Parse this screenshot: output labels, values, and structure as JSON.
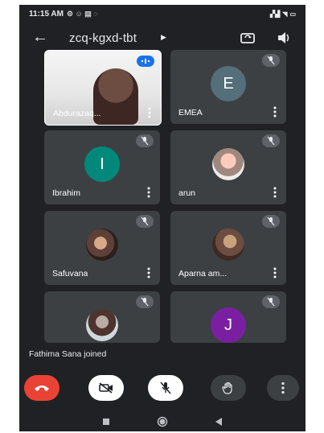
{
  "status": {
    "time": "11:15 AM"
  },
  "meeting": {
    "code": "zcq-kgxd-tbt"
  },
  "participants": [
    {
      "name": "Abdurazaq...",
      "type": "photo",
      "speaking": true
    },
    {
      "name": "EMEA",
      "type": "letter",
      "letter": "E",
      "color": "#546e7a",
      "muted": true
    },
    {
      "name": "Ibrahim",
      "type": "letter",
      "letter": "I",
      "color": "#00897b",
      "muted": true
    },
    {
      "name": "arun",
      "type": "photo",
      "muted": true
    },
    {
      "name": "Safuvana",
      "type": "photo",
      "muted": true
    },
    {
      "name": "Aparna am...",
      "type": "photo",
      "muted": true
    },
    {
      "name": "",
      "type": "photo",
      "muted": true
    },
    {
      "name": "",
      "type": "letter",
      "letter": "J",
      "color": "#7b1fa2",
      "muted": true
    }
  ],
  "toast": "Fathima Sana joined",
  "controls": [
    "end-call",
    "camera-off",
    "mic-off",
    "raise-hand",
    "more"
  ],
  "colors": {
    "background": "#202124",
    "tile": "#3c4043",
    "end_call": "#ea4335",
    "speaking": "#1a73e8"
  }
}
